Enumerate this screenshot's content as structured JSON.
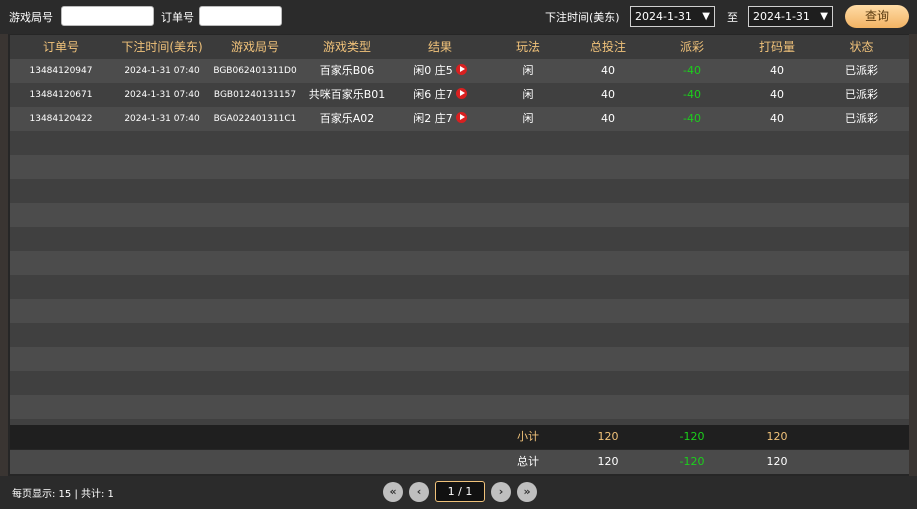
{
  "filters": {
    "game_round_label": "游戏局号",
    "order_no_label": "订单号",
    "time_label": "下注时间(美东)",
    "date_from": "2024-1-31",
    "to_label": "至",
    "date_to": "2024-1-31",
    "query_button": "查询"
  },
  "table": {
    "headers": [
      "订单号",
      "下注时间(美东)",
      "游戏局号",
      "游戏类型",
      "结果",
      "玩法",
      "总投注",
      "派彩",
      "打码量",
      "状态"
    ],
    "rows": [
      {
        "order_no": "13484120947",
        "time": "2024-1-31 07:40",
        "round": "BGB062401311D0",
        "game": "百家乐B06",
        "result": "闲0 庄5",
        "play": "闲",
        "bet": "40",
        "payout": "-40",
        "turnover": "40",
        "status": "已派彩"
      },
      {
        "order_no": "13484120671",
        "time": "2024-1-31 07:40",
        "round": "BGB01240131157",
        "game": "共咪百家乐B01",
        "result": "闲6 庄7",
        "play": "闲",
        "bet": "40",
        "payout": "-40",
        "turnover": "40",
        "status": "已派彩"
      },
      {
        "order_no": "13484120422",
        "time": "2024-1-31 07:40",
        "round": "BGA022401311C1",
        "game": "百家乐A02",
        "result": "闲2 庄7",
        "play": "闲",
        "bet": "40",
        "payout": "-40",
        "turnover": "40",
        "status": "已派彩"
      }
    ],
    "subtotal": {
      "label": "小计",
      "bet": "120",
      "payout": "-120",
      "turnover": "120"
    },
    "total": {
      "label": "总计",
      "bet": "120",
      "payout": "-120",
      "turnover": "120"
    }
  },
  "footer": {
    "page_info": "每页显示:  15  |  共计:  1",
    "page_indicator": "1 / 1"
  },
  "icons": {
    "first": "«",
    "prev": "‹",
    "next": "›",
    "last": "»"
  }
}
